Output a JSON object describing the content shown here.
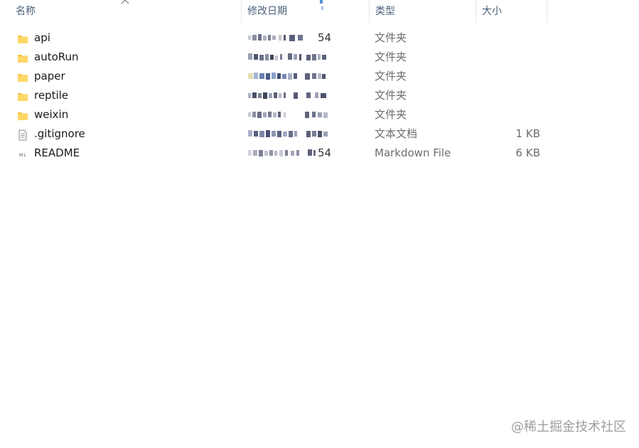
{
  "columns": {
    "name": "名称",
    "date": "修改日期",
    "type": "类型",
    "size": "大小"
  },
  "files": [
    {
      "name": "api",
      "icon": "folder-icon",
      "date_tail": "54",
      "type": "文件夹",
      "size": ""
    },
    {
      "name": "autoRun",
      "icon": "folder-icon",
      "date_tail": "",
      "type": "文件夹",
      "size": ""
    },
    {
      "name": "paper",
      "icon": "folder-icon",
      "date_tail": "",
      "type": "文件夹",
      "size": ""
    },
    {
      "name": "reptile",
      "icon": "folder-icon",
      "date_tail": "",
      "type": "文件夹",
      "size": ""
    },
    {
      "name": "weixin",
      "icon": "folder-icon",
      "date_tail": "",
      "type": "文件夹",
      "size": ""
    },
    {
      "name": ".gitignore",
      "icon": "text-file-icon",
      "date_tail": "",
      "type": "文本文档",
      "size": "1 KB"
    },
    {
      "name": "README",
      "icon": "markdown-file-icon",
      "date_tail": "54",
      "type": "Markdown File",
      "size": "6 KB"
    }
  ],
  "watermark": "@稀土掘金技术社区",
  "colors": {
    "header_text": "#4c607a",
    "folder": "#f5c342",
    "folder_dark": "#e0a82e",
    "secondary_text": "#6d6d6d"
  }
}
